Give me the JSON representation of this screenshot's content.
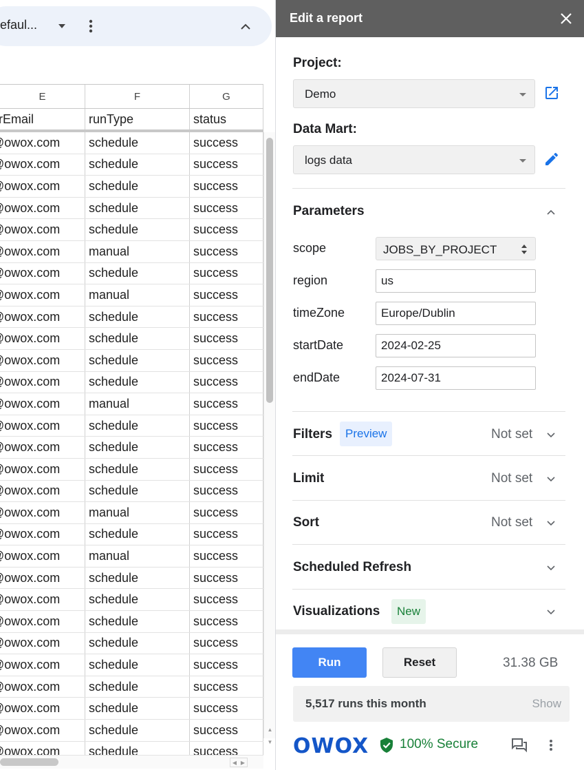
{
  "sheet": {
    "view_name": "efaul...",
    "columns": [
      "E",
      "F",
      "G"
    ],
    "fields": [
      "erEmail",
      "runType",
      "status"
    ],
    "rows": [
      [
        "@owox.com",
        "schedule",
        "success"
      ],
      [
        "@owox.com",
        "schedule",
        "success"
      ],
      [
        "@owox.com",
        "schedule",
        "success"
      ],
      [
        "@owox.com",
        "schedule",
        "success"
      ],
      [
        "@owox.com",
        "schedule",
        "success"
      ],
      [
        "@owox.com",
        "manual",
        "success"
      ],
      [
        "@owox.com",
        "schedule",
        "success"
      ],
      [
        "@owox.com",
        "manual",
        "success"
      ],
      [
        "@owox.com",
        "schedule",
        "success"
      ],
      [
        "@owox.com",
        "schedule",
        "success"
      ],
      [
        "@owox.com",
        "schedule",
        "success"
      ],
      [
        "@owox.com",
        "schedule",
        "success"
      ],
      [
        "@owox.com",
        "manual",
        "success"
      ],
      [
        "@owox.com",
        "schedule",
        "success"
      ],
      [
        "@owox.com",
        "schedule",
        "success"
      ],
      [
        "@owox.com",
        "schedule",
        "success"
      ],
      [
        "@owox.com",
        "schedule",
        "success"
      ],
      [
        "@owox.com",
        "manual",
        "success"
      ],
      [
        "@owox.com",
        "schedule",
        "success"
      ],
      [
        "@owox.com",
        "manual",
        "success"
      ],
      [
        "@owox.com",
        "schedule",
        "success"
      ],
      [
        "@owox.com",
        "schedule",
        "success"
      ],
      [
        "@owox.com",
        "schedule",
        "success"
      ],
      [
        "@owox.com",
        "schedule",
        "success"
      ],
      [
        "@owox.com",
        "schedule",
        "success"
      ],
      [
        "@owox.com",
        "schedule",
        "success"
      ],
      [
        "@owox.com",
        "schedule",
        "success"
      ],
      [
        "@owox.com",
        "schedule",
        "success"
      ],
      [
        "@owox.com",
        "schedule",
        "success"
      ]
    ]
  },
  "panel": {
    "title": "Edit a report",
    "project_label": "Project:",
    "project_value": "Demo",
    "datamart_label": "Data Mart:",
    "datamart_value": "logs data",
    "parameters_title": "Parameters",
    "params": {
      "scope_label": "scope",
      "scope_value": "JOBS_BY_PROJECT",
      "region_label": "region",
      "region_value": "us",
      "timezone_label": "timeZone",
      "timezone_value": "Europe/Dublin",
      "startdate_label": "startDate",
      "startdate_value": "2024-02-25",
      "enddate_label": "endDate",
      "enddate_value": "2024-07-31"
    },
    "filters_title": "Filters",
    "filters_badge": "Preview",
    "filters_value": "Not set",
    "limit_title": "Limit",
    "limit_value": "Not set",
    "sort_title": "Sort",
    "sort_value": "Not set",
    "scheduled_title": "Scheduled Refresh",
    "visualizations_title": "Visualizations",
    "visualizations_badge": "New",
    "run_label": "Run",
    "reset_label": "Reset",
    "data_size": "31.38 GB",
    "runs_text": "5,517 runs this month",
    "runs_show": "Show",
    "brand": "OWOX",
    "secure_text": "100% Secure"
  },
  "colors": {
    "header_bg": "#5f5f5f",
    "accent_blue": "#4285f4",
    "link_blue": "#1a73e8",
    "secure_green": "#188038"
  }
}
